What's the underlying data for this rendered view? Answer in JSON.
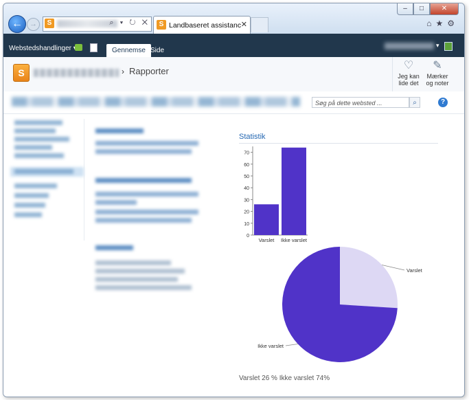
{
  "browser": {
    "tab_title": "Landbaseret assistance - Ra...",
    "tab_close": "✕",
    "favicon_letter": "S",
    "address_icons": "⌕ ▾ ↻ ✕",
    "window_buttons": {
      "minimize": "–",
      "maximize": "□",
      "close": "✕"
    },
    "toolbar_icons": {
      "home": "⌂",
      "favorites": "★",
      "tools": "⚙"
    }
  },
  "ribbon": {
    "site_actions": "Webstedshandlinger ▾",
    "tabs": [
      "Gennemse",
      "Side"
    ],
    "active_tab_index": 0,
    "user_caret": "▾"
  },
  "header": {
    "logo_letter": "S",
    "breadcrumb_separator": "›",
    "page_title": "Rapporter",
    "like_label": "Jeg kan lide det",
    "tags_label": "Mærker og noter"
  },
  "search": {
    "placeholder": "Søg på dette websted ...",
    "help": "?"
  },
  "webpart": {
    "title": "Statistik",
    "percent_summary": "Varslet 26 % Ikke varslet 74%"
  },
  "chart_data": [
    {
      "type": "bar",
      "categories": [
        "Varslet",
        "Ikke varslet"
      ],
      "values": [
        26,
        74
      ],
      "yticks": [
        0,
        10,
        20,
        30,
        40,
        50,
        60,
        70
      ],
      "ylim": [
        0,
        75
      ],
      "color": "#5033c8"
    },
    {
      "type": "pie",
      "labels": [
        "Varslet",
        "Ikke varslet"
      ],
      "values": [
        26,
        74
      ],
      "colors": [
        "#ddd8f4",
        "#5033c8"
      ]
    }
  ],
  "colors": {
    "ribbon": "#21374c",
    "accent": "#2467b2",
    "bar": "#5033c8"
  }
}
